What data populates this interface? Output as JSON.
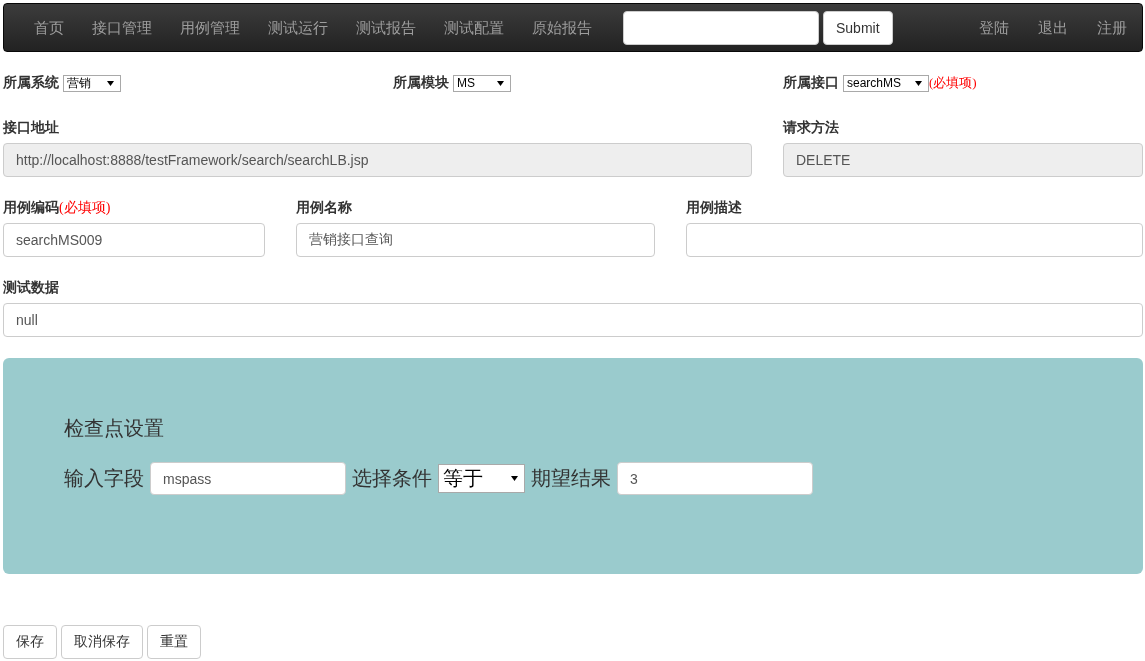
{
  "navbar": {
    "links": [
      "首页",
      "接口管理",
      "用例管理",
      "测试运行",
      "测试报告",
      "测试配置",
      "原始报告"
    ],
    "search_button": "Submit",
    "right_links": [
      "登陆",
      "退出",
      "注册"
    ]
  },
  "selectors": [
    {
      "label": "所属系统",
      "value": "营销"
    },
    {
      "label": "所属模块",
      "value": "MS"
    },
    {
      "label": "所属接口",
      "value": "searchMS",
      "required_note": "(必填项)"
    }
  ],
  "interface_fields": [
    {
      "label": "接口地址",
      "value": "http://localhost:8888/testFramework/search/searchLB.jsp",
      "disabled": true
    },
    {
      "label": "请求方法",
      "value": "DELETE",
      "disabled": true
    }
  ],
  "case_fields": [
    {
      "label": "用例编码",
      "required_note": "(必填项)",
      "value": "searchMS009",
      "disabled": false
    },
    {
      "label": "用例名称",
      "value": "营销接口查询",
      "disabled": false
    },
    {
      "label": "用例描述",
      "disabled": false
    }
  ],
  "test_data": {
    "label": "测试数据",
    "value": "null",
    "disabled": false
  },
  "checkpoint": {
    "title": "检查点设置",
    "field_label": "输入字段",
    "field_value": "mspass",
    "condition_label": "选择条件",
    "condition_value": "等于",
    "expected_label": "期望结果",
    "expected_value": "3"
  },
  "buttons": [
    "保存",
    "取消保存",
    "重置"
  ]
}
